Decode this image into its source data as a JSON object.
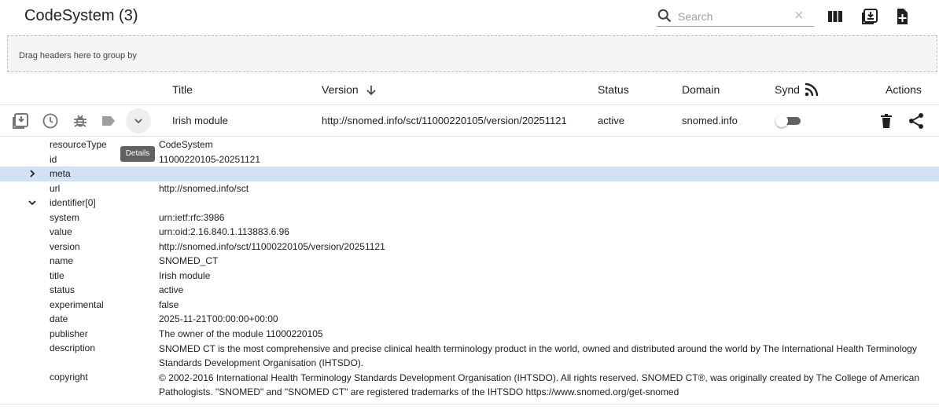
{
  "toolbar": {
    "title": "CodeSystem (3)",
    "search_placeholder": "Search",
    "clear_glyph": "×",
    "icons": [
      "search-icon",
      "clear-icon",
      "columns-icon",
      "import-icon",
      "add-icon"
    ]
  },
  "groupby": {
    "hint": "Drag headers here to group by"
  },
  "columns": {
    "title": "Title",
    "version": "Version",
    "status": "Status",
    "domain": "Domain",
    "synd": "Synd",
    "actions": "Actions"
  },
  "row": {
    "title": "Irish module",
    "version": "http://snomed.info/sct/11000220105/version/20251121",
    "status": "active",
    "domain": "snomed.info",
    "synd_enabled": false,
    "tooltip": "Details",
    "icons": [
      "export-icon",
      "history-icon",
      "bug-icon",
      "label-icon",
      "chevron-down-icon",
      "delete-icon",
      "share-icon"
    ]
  },
  "details": [
    {
      "key": "resourceType",
      "value": "CodeSystem"
    },
    {
      "key": "id",
      "value": "11000220105-20251121"
    },
    {
      "key": "meta",
      "value": "",
      "caret": "collapsed",
      "highlight": true
    },
    {
      "key": "url",
      "value": "http://snomed.info/sct"
    },
    {
      "key": "identifier[0]",
      "value": "",
      "caret": "expanded"
    },
    {
      "key": "system",
      "value": "urn:ietf:rfc:3986"
    },
    {
      "key": "value",
      "value": "urn:oid:2.16.840.1.113883.6.96"
    },
    {
      "key": "version",
      "value": "http://snomed.info/sct/11000220105/version/20251121"
    },
    {
      "key": "name",
      "value": "SNOMED_CT"
    },
    {
      "key": "title",
      "value": "Irish module"
    },
    {
      "key": "status",
      "value": "active"
    },
    {
      "key": "experimental",
      "value": "false"
    },
    {
      "key": "date",
      "value": "2025-11-21T00:00:00+00:00"
    },
    {
      "key": "publisher",
      "value": "The owner of the module 11000220105"
    },
    {
      "key": "description",
      "value": "SNOMED CT is the most comprehensive and precise clinical health terminology product in the world, owned and distributed around the world by The International Health Terminology Standards Development Organisation (IHTSDO).",
      "tall": true
    },
    {
      "key": "copyright",
      "value": "© 2002-2016 International Health Terminology Standards Development Organisation (IHTSDO). All rights reserved. SNOMED CT®, was originally created by The College of American Pathologists. \"SNOMED\" and \"SNOMED CT\" are registered trademarks of the IHTSDO https://www.snomed.org/get-snomed",
      "tall": true
    }
  ],
  "colors": {
    "highlight_row": "#d1e3f2",
    "icon_gray": "#9e9e9e",
    "icon_dark": "#212121",
    "tooltip_bg": "#616161"
  }
}
